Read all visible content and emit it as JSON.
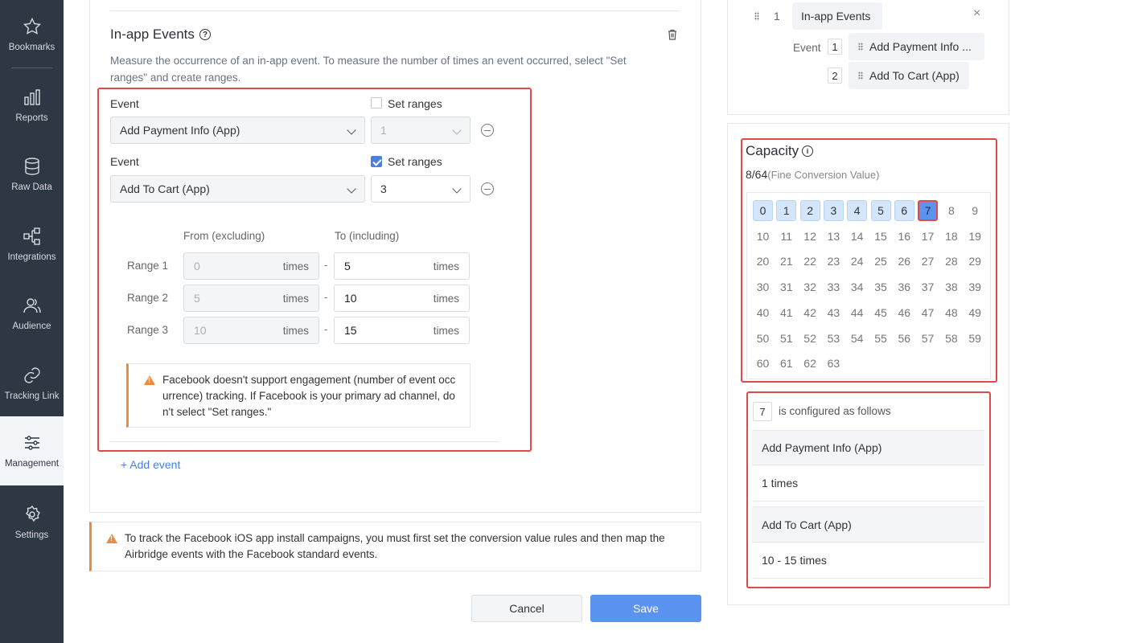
{
  "sidebar": {
    "items": [
      {
        "label": "Bookmarks",
        "icon": "star-icon"
      },
      {
        "label": "Reports",
        "icon": "bar-chart-icon"
      },
      {
        "label": "Raw Data",
        "icon": "database-icon"
      },
      {
        "label": "Integrations",
        "icon": "integrations-icon"
      },
      {
        "label": "Audience",
        "icon": "audience-icon"
      },
      {
        "label": "Tracking Link",
        "icon": "link-icon"
      },
      {
        "label": "Management",
        "icon": "sliders-icon"
      },
      {
        "label": "Settings",
        "icon": "gear-icon"
      }
    ],
    "active": "Management"
  },
  "section": {
    "title": "In-app Events",
    "description": "Measure the occurrence of an in-app event. To measure the number of times an event occurred, select \"Set ranges\" and create ranges.",
    "events": [
      {
        "label": "Event",
        "value": "Add Payment Info (App)",
        "set_ranges_label": "Set ranges",
        "set_ranges_checked": false,
        "count": "1"
      },
      {
        "label": "Event",
        "value": "Add To Cart (App)",
        "set_ranges_label": "Set ranges",
        "set_ranges_checked": true,
        "count": "3"
      }
    ],
    "ranges": {
      "from_header": "From (excluding)",
      "to_header": "To (including)",
      "unit": "times",
      "rows": [
        {
          "label": "Range 1",
          "from": "0",
          "to": "5"
        },
        {
          "label": "Range 2",
          "from": "5",
          "to": "10"
        },
        {
          "label": "Range 3",
          "from": "10",
          "to": "15"
        }
      ]
    },
    "inner_warning": "Facebook doesn't support engagement (number of event occurrence) tracking. If Facebook is your primary ad channel, don't select \"Set ranges.\"",
    "add_event": "+ Add event"
  },
  "bottom_warning": "To track the Facebook iOS app install campaigns, you must first set the conversion value rules and then map the Airbridge events with the Facebook standard events.",
  "buttons": {
    "cancel": "Cancel",
    "save": "Save"
  },
  "summary": {
    "index": "1",
    "name": "In-app Events",
    "event_label": "Event",
    "events": [
      {
        "num": "1",
        "name": "Add Payment Info ..."
      },
      {
        "num": "2",
        "name": "Add To Cart (App)"
      }
    ]
  },
  "capacity": {
    "title": "Capacity",
    "used": "8/64",
    "suffix": "(Fine Conversion Value)",
    "total": 64,
    "configured": [
      0,
      1,
      2,
      3,
      4,
      5,
      6,
      7
    ],
    "selected": 7
  },
  "config": {
    "value": "7",
    "text": "is configured as follows",
    "rows": [
      {
        "event": "Add Payment Info (App)",
        "detail": "1 times"
      },
      {
        "event": "Add To Cart (App)",
        "detail": "10 - 15 times"
      }
    ]
  }
}
